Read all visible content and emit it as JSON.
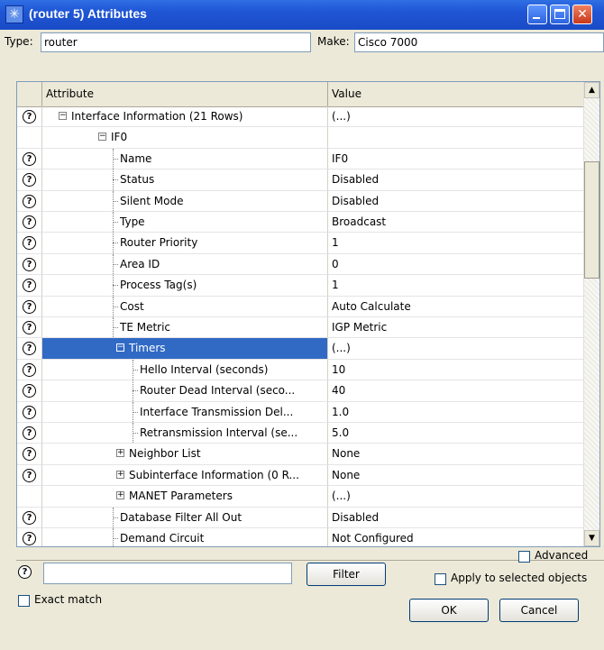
{
  "window": {
    "title": "(router 5) Attributes"
  },
  "type_field": {
    "label": "Type:",
    "value": "router"
  },
  "make_field": {
    "label": "Make:",
    "value": "Cisco 7000"
  },
  "table": {
    "headers": [
      "Attribute",
      "Value"
    ],
    "rows": [
      {
        "attr": "Interface Information (21 Rows)",
        "value": "(...)",
        "help": true,
        "level": 0,
        "expander": "minus",
        "selected": false
      },
      {
        "attr": "IF0",
        "value": "",
        "help": false,
        "level": 1,
        "expander": "minus",
        "selected": false
      },
      {
        "attr": "Name",
        "value": "IF0",
        "help": true,
        "level": 2,
        "expander": "",
        "selected": false
      },
      {
        "attr": "Status",
        "value": "Disabled",
        "help": true,
        "level": 2,
        "expander": "",
        "selected": false
      },
      {
        "attr": "Silent Mode",
        "value": "Disabled",
        "help": true,
        "level": 2,
        "expander": "",
        "selected": false
      },
      {
        "attr": "Type",
        "value": "Broadcast",
        "help": true,
        "level": 2,
        "expander": "",
        "selected": false
      },
      {
        "attr": "Router Priority",
        "value": "1",
        "help": true,
        "level": 2,
        "expander": "",
        "selected": false
      },
      {
        "attr": "Area ID",
        "value": "0",
        "help": true,
        "level": 2,
        "expander": "",
        "selected": false
      },
      {
        "attr": "Process Tag(s)",
        "value": "1",
        "help": true,
        "level": 2,
        "expander": "",
        "selected": false
      },
      {
        "attr": "Cost",
        "value": "Auto Calculate",
        "help": true,
        "level": 2,
        "expander": "",
        "selected": false
      },
      {
        "attr": "TE Metric",
        "value": "IGP Metric",
        "help": true,
        "level": 2,
        "expander": "",
        "selected": false
      },
      {
        "attr": "Timers",
        "value": "(...)",
        "help": true,
        "level": 2,
        "expander": "minus",
        "selected": true
      },
      {
        "attr": "Hello Interval (seconds)",
        "value": "10",
        "help": true,
        "level": 3,
        "expander": "",
        "selected": false
      },
      {
        "attr": "Router Dead Interval (seco...",
        "value": "40",
        "help": true,
        "level": 3,
        "expander": "",
        "selected": false
      },
      {
        "attr": "Interface Transmission Del...",
        "value": "1.0",
        "help": true,
        "level": 3,
        "expander": "",
        "selected": false
      },
      {
        "attr": "Retransmission Interval (se...",
        "value": "5.0",
        "help": true,
        "level": 3,
        "expander": "",
        "selected": false
      },
      {
        "attr": "Neighbor List",
        "value": "None",
        "help": true,
        "level": 2,
        "expander": "plus",
        "selected": false
      },
      {
        "attr": "Subinterface Information (0 R...",
        "value": "None",
        "help": true,
        "level": 2,
        "expander": "plus",
        "selected": false
      },
      {
        "attr": "MANET Parameters",
        "value": "(...)",
        "help": false,
        "level": 2,
        "expander": "plus",
        "selected": false
      },
      {
        "attr": "Database Filter All Out",
        "value": "Disabled",
        "help": true,
        "level": 2,
        "expander": "",
        "selected": false
      },
      {
        "attr": "Demand Circuit",
        "value": "Not Configured",
        "help": true,
        "level": 2,
        "expander": "",
        "selected": false
      }
    ]
  },
  "bottom": {
    "help_glyph": "?",
    "filter_text": "",
    "filter_button": "Filter",
    "exact_match_label": "Exact match",
    "advanced_label": "Advanced",
    "apply_label": "Apply to selected objects",
    "ok_label": "OK",
    "cancel_label": "Cancel"
  }
}
